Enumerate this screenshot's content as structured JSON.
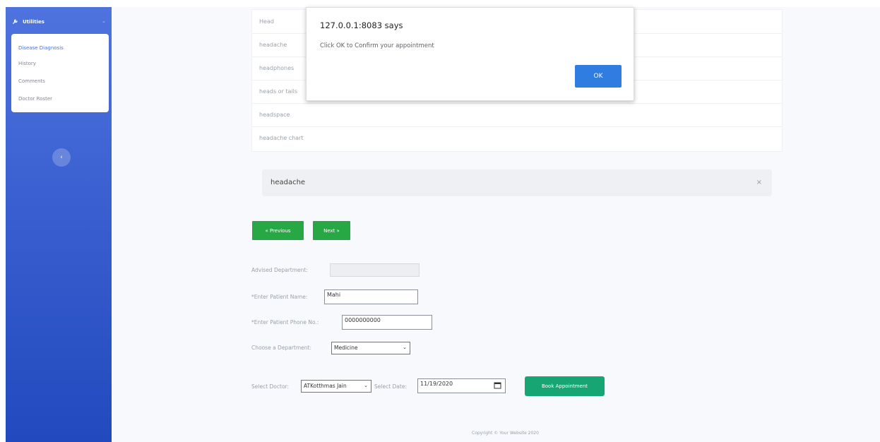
{
  "sidebar": {
    "heading": "Utilities",
    "items": [
      {
        "label": "Disease Diagnosis",
        "active": true
      },
      {
        "label": "History",
        "active": false
      },
      {
        "label": "Comments",
        "active": false
      },
      {
        "label": "Doctor Roster",
        "active": false
      }
    ],
    "collapse_symbol": "‹"
  },
  "search": {
    "typed_value": "Head",
    "suggestions": [
      "headache",
      "headphones",
      "heads or tails",
      "headspace",
      "headache chart"
    ],
    "selected_value": "headache",
    "clear_symbol": "×"
  },
  "buttons": {
    "previous": "« Previous",
    "next": "Next »",
    "book": "Book Appointment"
  },
  "form": {
    "advised_department_label": "Advised Department:",
    "advised_department_value": "",
    "patient_name_label": "*Enter Patient Name:",
    "patient_name_value": "Mahi",
    "phone_label": "*Enter Patient Phone No.:",
    "phone_value": "0000000000",
    "department_label": "Choose a Department:",
    "department_value": "Medicine",
    "doctor_label": "Select Doctor:",
    "doctor_value": "ATKotthmas Jain",
    "date_label": "Select Date:",
    "date_value": "11/19/2020"
  },
  "dialog": {
    "title": "127.0.0.1:8083 says",
    "message": "Click OK to Confirm your appointment",
    "ok_label": "OK"
  },
  "footer": {
    "text": "Copyright © Your Website 2020"
  },
  "colors": {
    "sidebar": "#4e73df",
    "green_button": "#28a745",
    "book_button": "#17a673",
    "dialog_ok": "#2f7de1"
  }
}
